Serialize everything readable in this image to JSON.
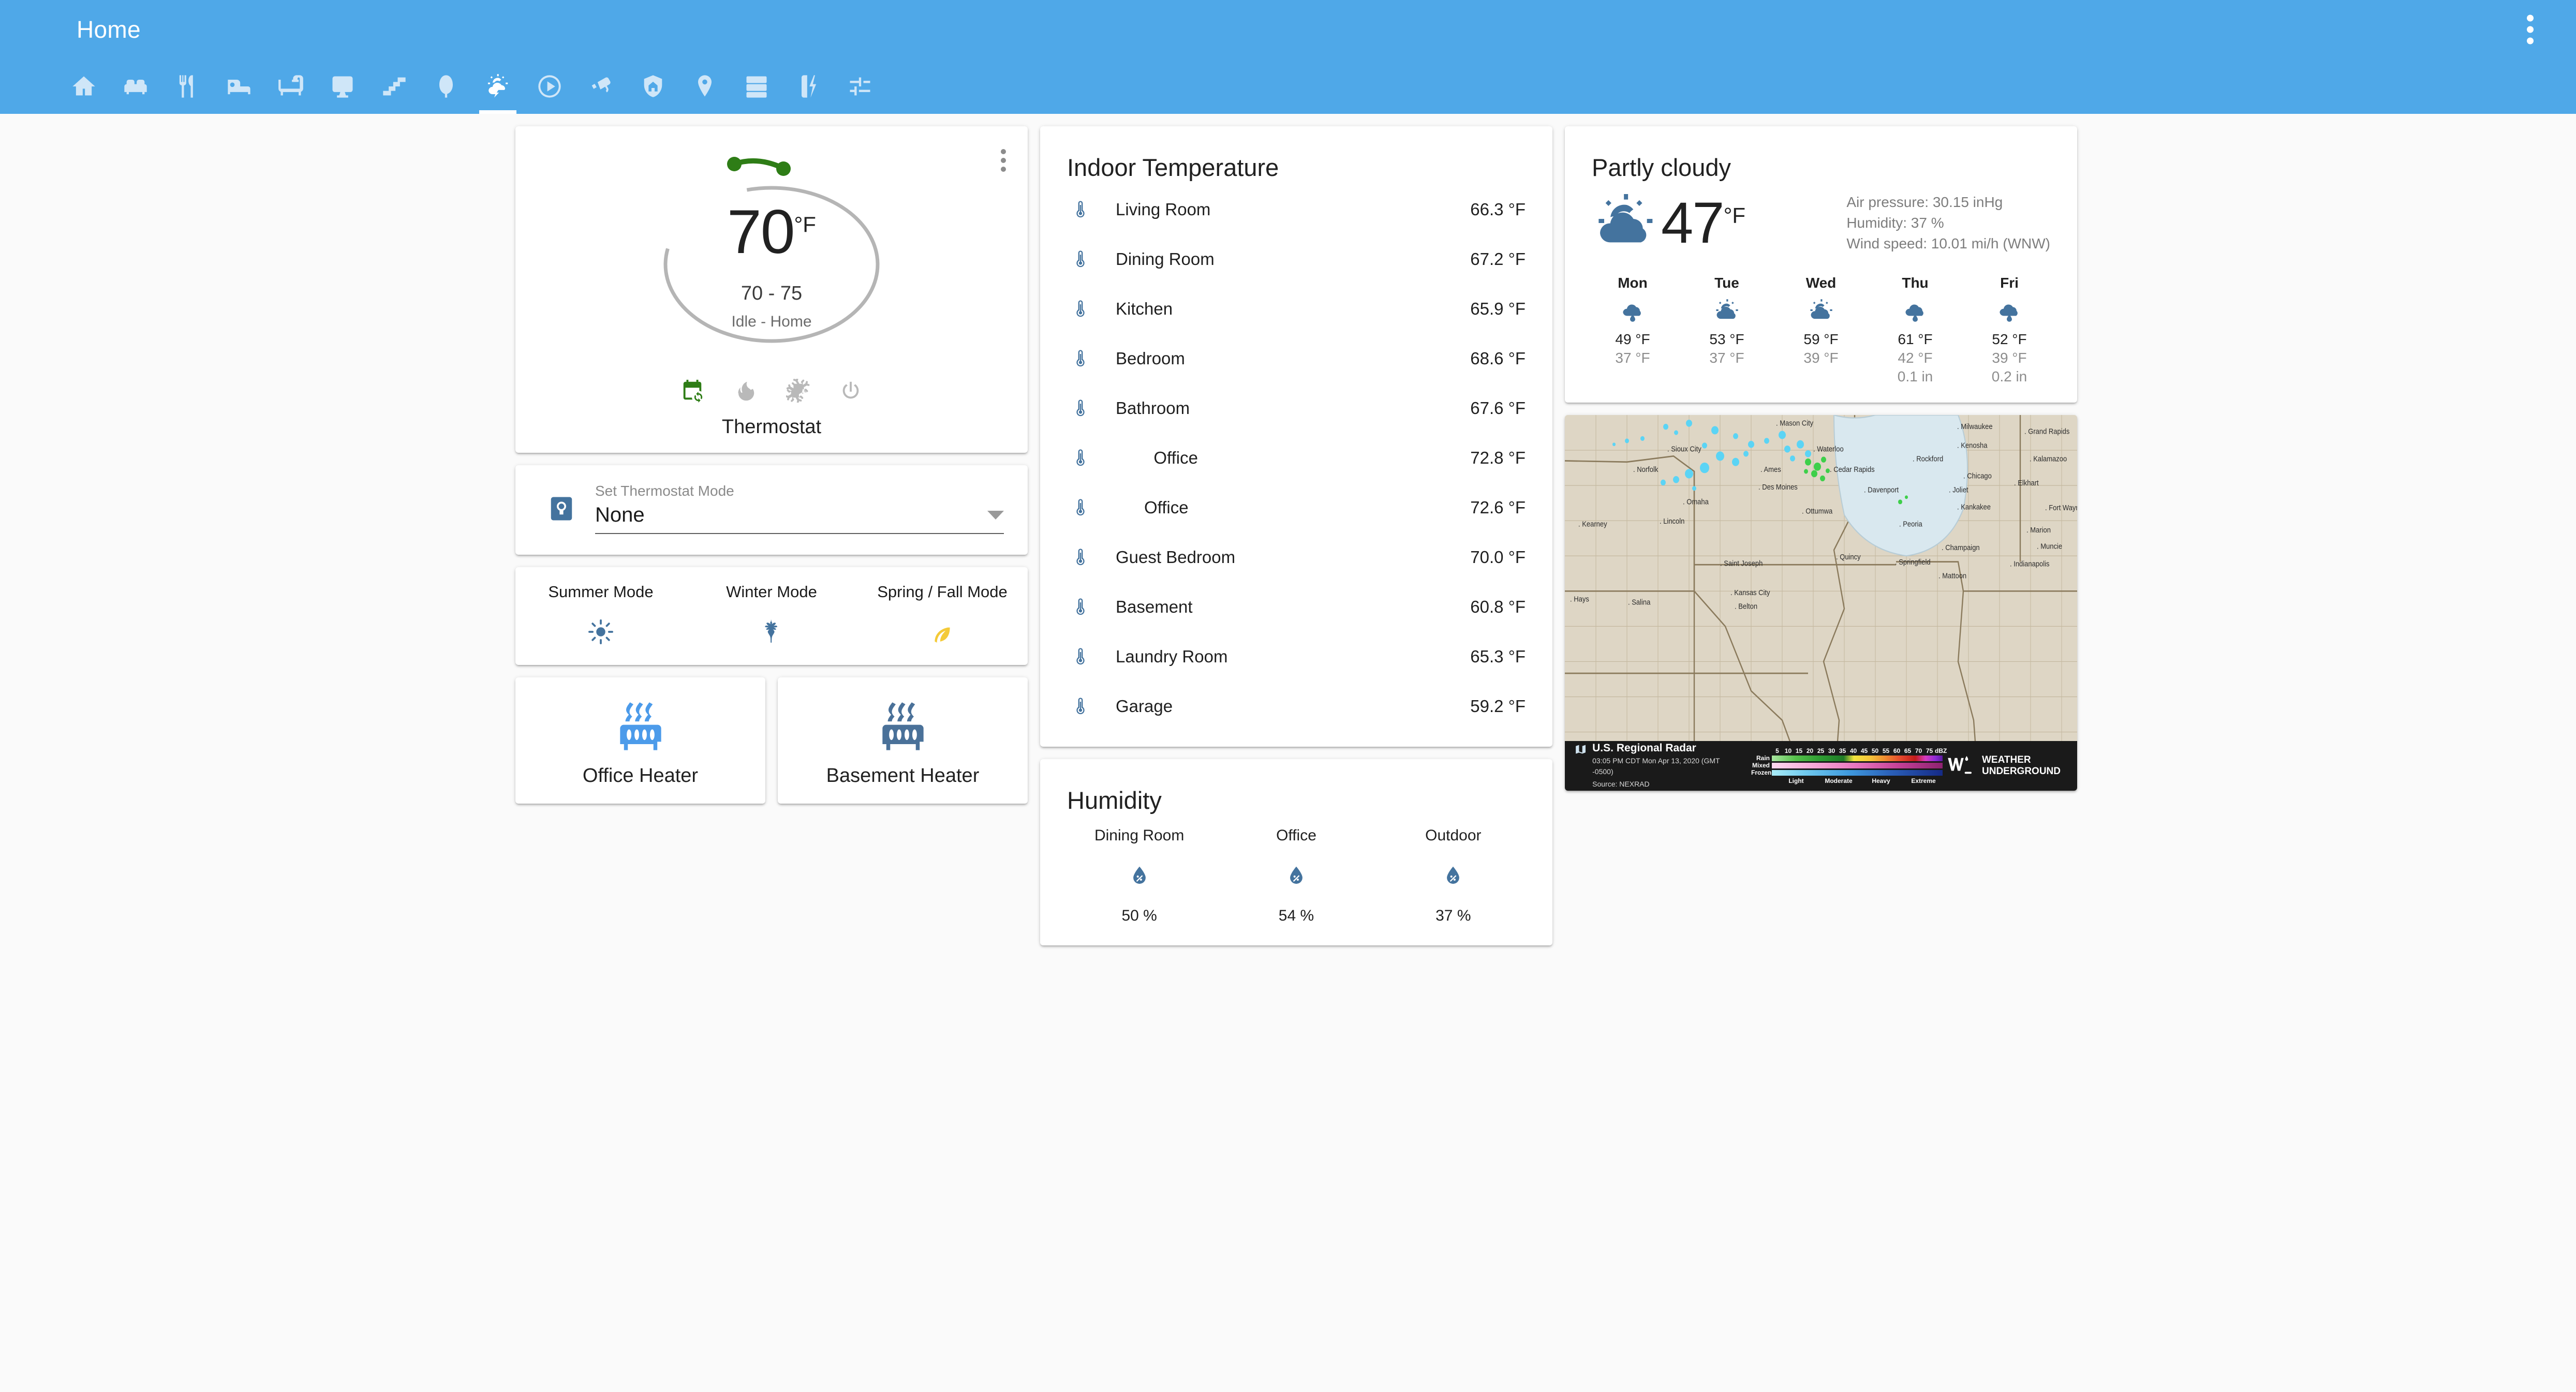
{
  "app": {
    "title": "Home",
    "overflow_icon": "dots-vertical-icon",
    "accent_color": "#4FA8E8"
  },
  "tabs": [
    {
      "icon": "home-icon",
      "name": "tab-home",
      "active": false
    },
    {
      "icon": "sofa-icon",
      "name": "tab-living-room",
      "active": false
    },
    {
      "icon": "silverware-fork-knife-icon",
      "name": "tab-kitchen",
      "active": false
    },
    {
      "icon": "bed-icon",
      "name": "tab-bedroom",
      "active": false
    },
    {
      "icon": "bathtub-icon",
      "name": "tab-bathroom",
      "active": false
    },
    {
      "icon": "desktop-monitor-icon",
      "name": "tab-office",
      "active": false
    },
    {
      "icon": "stairs-icon",
      "name": "tab-stairs",
      "active": false
    },
    {
      "icon": "tree-icon",
      "name": "tab-outdoor",
      "active": false
    },
    {
      "icon": "weather-lightning-cloud-icon",
      "name": "tab-climate",
      "active": true
    },
    {
      "icon": "play-circle-icon",
      "name": "tab-media",
      "active": false
    },
    {
      "icon": "cctv-camera-icon",
      "name": "tab-cameras",
      "active": false
    },
    {
      "icon": "shield-home-icon",
      "name": "tab-security",
      "active": false
    },
    {
      "icon": "map-marker-icon",
      "name": "tab-location",
      "active": false
    },
    {
      "icon": "server-icon",
      "name": "tab-system",
      "active": false
    },
    {
      "icon": "flash-battery-icon",
      "name": "tab-energy",
      "active": false
    },
    {
      "icon": "tune-sliders-icon",
      "name": "tab-settings",
      "active": false
    }
  ],
  "thermostat": {
    "menu_icon": "dots-vertical-icon",
    "current_temperature": "70",
    "unit": "°F",
    "target_range": "70 - 75",
    "state": "Idle - Home",
    "name": "Thermostat",
    "low_setpoint": 70,
    "high_setpoint": 75,
    "modes": [
      {
        "icon": "calendar-sync-icon",
        "name": "mode-auto",
        "active": true,
        "color": "#2E7D16"
      },
      {
        "icon": "fire-icon",
        "name": "mode-heat",
        "active": false,
        "color": "#b9b9b9"
      },
      {
        "icon": "snowflake-icon",
        "name": "mode-cool",
        "active": false,
        "color": "#b9b9b9"
      },
      {
        "icon": "power-icon",
        "name": "mode-off",
        "active": false,
        "color": "#b9b9b9"
      }
    ]
  },
  "thermostat_mode_select": {
    "icon": "thermostat-mode-icon",
    "label": "Set Thermostat Mode",
    "value": "None",
    "caret_icon": "chevron-down-icon"
  },
  "season_modes": [
    {
      "label": "Summer Mode",
      "icon": "sun-icon",
      "color": "#44739E",
      "name": "summer-mode-button"
    },
    {
      "label": "Winter Mode",
      "icon": "snowflake-icon",
      "color": "#44739E",
      "name": "winter-mode-button"
    },
    {
      "label": "Spring / Fall Mode",
      "icon": "leaf-icon",
      "color": "#F4CA38",
      "name": "spring-fall-mode-button"
    }
  ],
  "heaters": [
    {
      "label": "Office Heater",
      "icon": "radiator-icon",
      "color": "#4C9BEA",
      "state": "on",
      "name": "office-heater-button"
    },
    {
      "label": "Basement Heater",
      "icon": "radiator-icon",
      "color": "#4A7199",
      "state": "off",
      "name": "basement-heater-button"
    }
  ],
  "indoor_temperature": {
    "title": "Indoor Temperature",
    "rows": [
      {
        "icon": "thermometer-icon",
        "name": "Living Room",
        "value": "66.3 °F"
      },
      {
        "icon": "thermometer-icon",
        "name": "Dining Room",
        "value": "67.2 °F"
      },
      {
        "icon": "thermometer-icon",
        "name": "Kitchen",
        "value": "65.9 °F"
      },
      {
        "icon": "thermometer-icon",
        "name": "Bedroom",
        "value": "68.6 °F"
      },
      {
        "icon": "thermometer-icon",
        "name": "Bathroom",
        "value": "67.6 °F"
      },
      {
        "icon": "thermometer-icon",
        "name": "        Office",
        "value": "72.8 °F"
      },
      {
        "icon": "thermometer-icon",
        "name": "      Office",
        "value": "72.6 °F"
      },
      {
        "icon": "thermometer-icon",
        "name": "Guest Bedroom",
        "value": "70.0 °F"
      },
      {
        "icon": "thermometer-icon",
        "name": "Basement",
        "value": "60.8 °F"
      },
      {
        "icon": "thermometer-icon",
        "name": "Laundry Room",
        "value": "65.3 °F"
      },
      {
        "icon": "thermometer-icon",
        "name": "Garage",
        "value": "59.2 °F"
      }
    ]
  },
  "humidity": {
    "title": "Humidity",
    "items": [
      {
        "name": "Dining Room",
        "icon": "water-percent-icon",
        "value": "50 %"
      },
      {
        "name": "Office",
        "icon": "water-percent-icon",
        "value": "54 %"
      },
      {
        "name": "Outdoor",
        "icon": "water-percent-icon",
        "value": "37 %"
      }
    ]
  },
  "weather": {
    "condition": "Partly cloudy",
    "icon": "weather-partly-cloudy-icon",
    "temperature": "47",
    "unit": "°F",
    "attributes": [
      "Air pressure: 30.15 inHg",
      "Humidity: 37 %",
      "Wind speed: 10.01 mi/h (WNW)"
    ],
    "forecast": [
      {
        "day": "Mon",
        "icon": "weather-rainy-icon",
        "high": "49 °F",
        "low": "37 °F",
        "precip": ""
      },
      {
        "day": "Tue",
        "icon": "weather-partly-cloudy-icon",
        "high": "53 °F",
        "low": "37 °F",
        "precip": ""
      },
      {
        "day": "Wed",
        "icon": "weather-partly-cloudy-icon",
        "high": "59 °F",
        "low": "39 °F",
        "precip": ""
      },
      {
        "day": "Thu",
        "icon": "weather-rainy-icon",
        "high": "61 °F",
        "low": "42 °F",
        "precip": "0.1 in"
      },
      {
        "day": "Fri",
        "icon": "weather-rainy-icon",
        "high": "52 °F",
        "low": "39 °F",
        "precip": "0.2 in"
      }
    ]
  },
  "radar": {
    "title": "U.S. Regional Radar",
    "timestamp": "03:05 PM CDT Mon Apr 13, 2020 (GMT -0500)",
    "source": "Source: NEXRAD",
    "map_icon": "map-icon",
    "dbz_ticks": [
      "5",
      "10",
      "15",
      "20",
      "25",
      "30",
      "35",
      "40",
      "45",
      "50",
      "55",
      "60",
      "65",
      "70",
      "75",
      "dBZ"
    ],
    "bands": [
      "Rain",
      "Mixed",
      "Frozen"
    ],
    "categories": [
      "Light",
      "Moderate",
      "Heavy",
      "Extreme"
    ],
    "brand": "WEATHER\nUNDERGROUND",
    "brand_line1": "WEATHER",
    "brand_line2": "UNDERGROUND",
    "brand_icon": "weather-underground-logo",
    "cities": [
      "Mason City",
      "Sioux City",
      "Norfolk",
      "Ames",
      "Des Moines",
      "Omaha",
      "Kearney",
      "Lincoln",
      "Ottumwa",
      "Saint Joseph",
      "Kansas City",
      "Belton",
      "Hays",
      "Salina",
      "Cedar Rapids",
      "Davenport",
      "Rockford",
      "Milwaukee",
      "Kenosha",
      "Chicago",
      "Joliet",
      "Kankakee",
      "Peoria",
      "Springfield",
      "Champaign",
      "Mattoon",
      "Quincy",
      "Indianapolis",
      "Muncie",
      "Marion",
      "Elkhart",
      "Fort Wayne",
      "Kalamazoo",
      "Grand Rapids",
      "Waterloo"
    ]
  }
}
